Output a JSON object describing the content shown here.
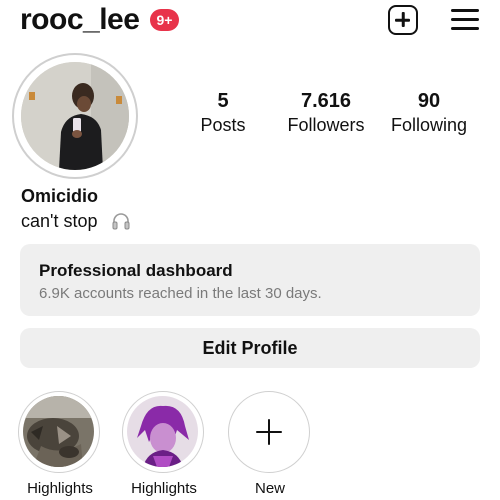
{
  "header": {
    "username": "rooc_lee",
    "notification_badge": "9+",
    "create_icon": "plus-square-icon",
    "menu_icon": "hamburger-menu-icon"
  },
  "profile": {
    "display_name": "Omicidio",
    "bio": "can't stop",
    "bio_emoji_icon": "headphones-icon"
  },
  "stats": [
    {
      "value": "5",
      "label": "Posts"
    },
    {
      "value": "7.616",
      "label": "Followers"
    },
    {
      "value": "90",
      "label": "Following"
    }
  ],
  "dashboard": {
    "title": "Professional dashboard",
    "subtitle": "6.9K accounts reached in the last 30 days."
  },
  "actions": {
    "edit_profile": "Edit Profile"
  },
  "highlights": [
    {
      "label": "Highlights"
    },
    {
      "label": "Highlights"
    },
    {
      "label": "New"
    }
  ],
  "colors": {
    "badge": "#e8334a",
    "card_background": "#efefef",
    "secondary_text": "#7a7a7a"
  }
}
